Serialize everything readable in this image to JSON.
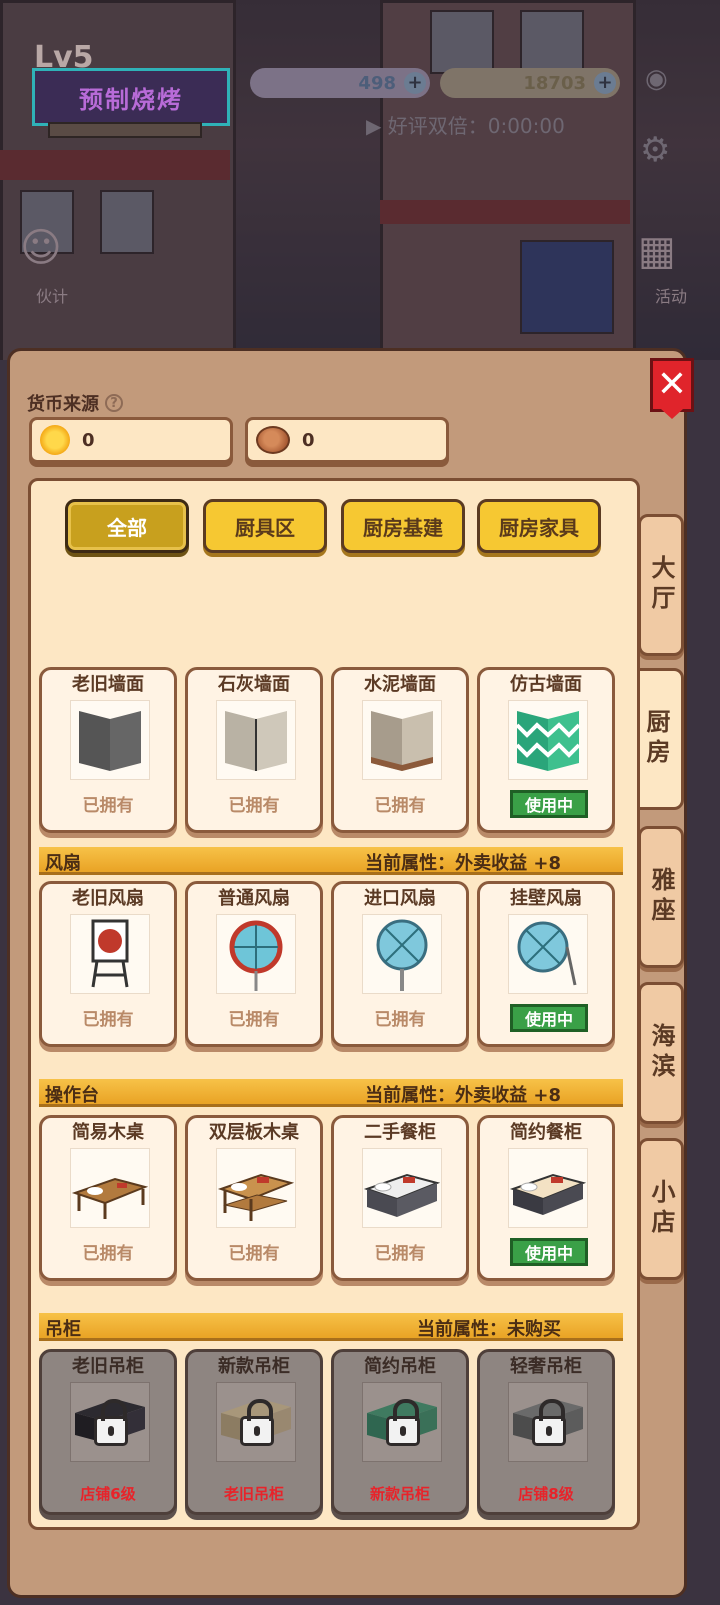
{
  "hud": {
    "level": "Lv5",
    "shop_name": "预制烧烤",
    "gems": "498",
    "coins": "18703",
    "ad_text": "好评双倍：0:00:00",
    "left_icon_label": "伙计",
    "right_icon_label": "活动"
  },
  "panel": {
    "close_label": "✕",
    "currency_label": "货币来源",
    "help_label": "?",
    "currencies": [
      {
        "icon": "sun-icon",
        "value": "0"
      },
      {
        "icon": "coin-icon",
        "value": "0"
      }
    ]
  },
  "filter_tabs": [
    "全部",
    "厨具区",
    "厨房基建",
    "厨房家具"
  ],
  "side_tabs": [
    "大厅",
    "厨房",
    "雅座",
    "海滨",
    "小店"
  ],
  "walls": {
    "items": [
      {
        "name": "老旧墙面",
        "status": "已拥有"
      },
      {
        "name": "石灰墙面",
        "status": "已拥有"
      },
      {
        "name": "水泥墙面",
        "status": "已拥有"
      },
      {
        "name": "仿古墙面",
        "status": "使用中"
      }
    ]
  },
  "fans": {
    "title": "风扇",
    "attr": "当前属性：外卖收益 +8",
    "items": [
      {
        "name": "老旧风扇",
        "status": "已拥有"
      },
      {
        "name": "普通风扇",
        "status": "已拥有"
      },
      {
        "name": "进口风扇",
        "status": "已拥有"
      },
      {
        "name": "挂壁风扇",
        "status": "使用中"
      }
    ]
  },
  "counters": {
    "title": "操作台",
    "attr": "当前属性：外卖收益 +8",
    "items": [
      {
        "name": "简易木桌",
        "status": "已拥有"
      },
      {
        "name": "双层板木桌",
        "status": "已拥有"
      },
      {
        "name": "二手餐柜",
        "status": "已拥有"
      },
      {
        "name": "简约餐柜",
        "status": "使用中"
      }
    ]
  },
  "cabinets": {
    "title": "吊柜",
    "attr": "当前属性：未购买",
    "items": [
      {
        "name": "老旧吊柜",
        "req": "店铺6级"
      },
      {
        "name": "新款吊柜",
        "req": "老旧吊柜"
      },
      {
        "name": "简约吊柜",
        "req": "新款吊柜"
      },
      {
        "name": "轻奢吊柜",
        "req": "店铺8级"
      }
    ]
  },
  "colors": {
    "accent": "#f6c832",
    "in_use": "#3aa047",
    "close": "#e0242b",
    "locked_req": "#e8232a"
  }
}
